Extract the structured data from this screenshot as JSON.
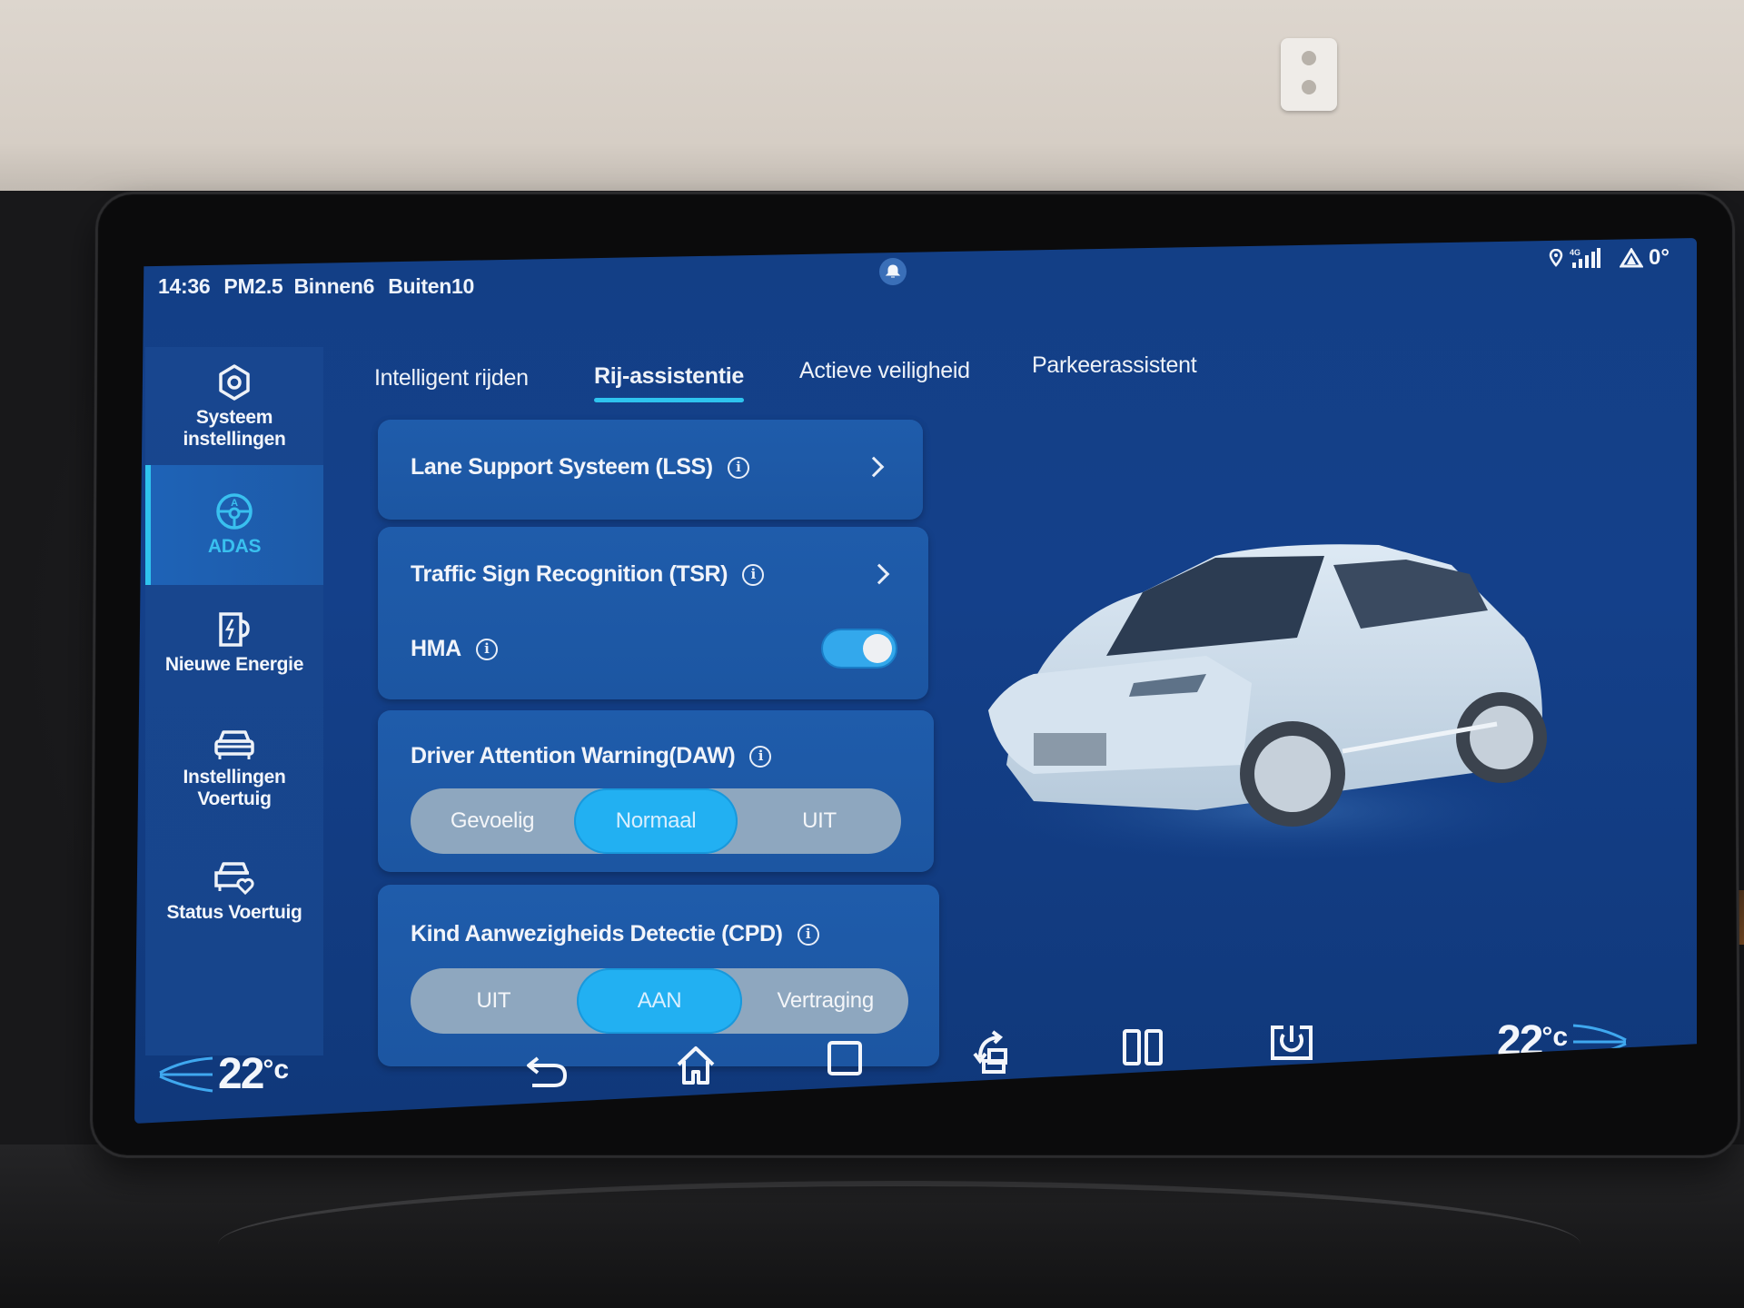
{
  "status_bar": {
    "time": "14:36",
    "pm25_label": "PM2.5",
    "indoor": "Binnen6",
    "outdoor": "Buiten10",
    "center_icon": "bell-icon",
    "right_icons": [
      "location-icon",
      "4g-signal-icon",
      "alert-triangle-icon"
    ],
    "outside_temp": "0°"
  },
  "sidebar": {
    "items": [
      {
        "label_line1": "Systeem",
        "label_line2": "instellingen",
        "icon": "gear-hexagon-icon",
        "active": false
      },
      {
        "label_line1": "ADAS",
        "label_line2": "",
        "icon": "steering-wheel-icon",
        "active": true
      },
      {
        "label_line1": "Nieuwe Energie",
        "label_line2": "",
        "icon": "charger-icon",
        "active": false
      },
      {
        "label_line1": "Instellingen",
        "label_line2": "Voertuig",
        "icon": "car-front-icon",
        "active": false
      },
      {
        "label_line1": "Status Voertuig",
        "label_line2": "",
        "icon": "car-heart-icon",
        "active": false
      }
    ]
  },
  "tabs": [
    {
      "label": "Intelligent rijden",
      "active": false
    },
    {
      "label": "Rij-assistentie",
      "active": true
    },
    {
      "label": "Actieve veiligheid",
      "active": false
    },
    {
      "label": "Parkeerassistent",
      "active": false
    }
  ],
  "settings": {
    "lss": {
      "label": "Lane Support Systeem (LSS)"
    },
    "tsr": {
      "label": "Traffic Sign Recognition (TSR)"
    },
    "hma": {
      "label": "HMA",
      "enabled": true
    },
    "daw": {
      "label": "Driver Attention Warning(DAW)",
      "options": [
        "Gevoelig",
        "Normaal",
        "UIT"
      ],
      "selected": "Normaal"
    },
    "cpd": {
      "label": "Kind Aanwezigheids Detectie (CPD)",
      "options": [
        "UIT",
        "AAN",
        "Vertraging"
      ],
      "selected": "AAN"
    }
  },
  "bottom_bar": {
    "temp_left": "22",
    "temp_right": "22",
    "temp_unit": "°c",
    "nav_icons": [
      "back-icon",
      "home-icon",
      "recents-icon",
      "rotate-screen-icon",
      "split-screen-icon",
      "screen-off-icon"
    ]
  },
  "colors": {
    "accent": "#2ec4ef",
    "screen_bg": "#14408a",
    "card_bg": "#1f5cab",
    "segment_bg": "#8ea7bf",
    "segment_active": "#22b0f2"
  }
}
